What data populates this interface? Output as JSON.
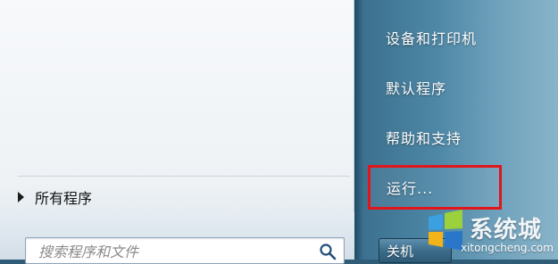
{
  "start_menu": {
    "left": {
      "all_programs_label": "所有程序",
      "search_placeholder": "搜索程序和文件"
    },
    "right": {
      "items": [
        {
          "label": "设备和打印机"
        },
        {
          "label": "默认程序"
        },
        {
          "label": "帮助和支持"
        },
        {
          "label": "运行...",
          "highlighted": true,
          "highlight_color": "#e2151b"
        }
      ],
      "shutdown_label": "关机"
    }
  },
  "watermark": {
    "name": "系统城",
    "url": "xitongcheng.com"
  },
  "icons": {
    "all_programs": "triangle-right-icon",
    "search": "magnifier-icon",
    "watermark_logo": "windows-style-logo"
  }
}
